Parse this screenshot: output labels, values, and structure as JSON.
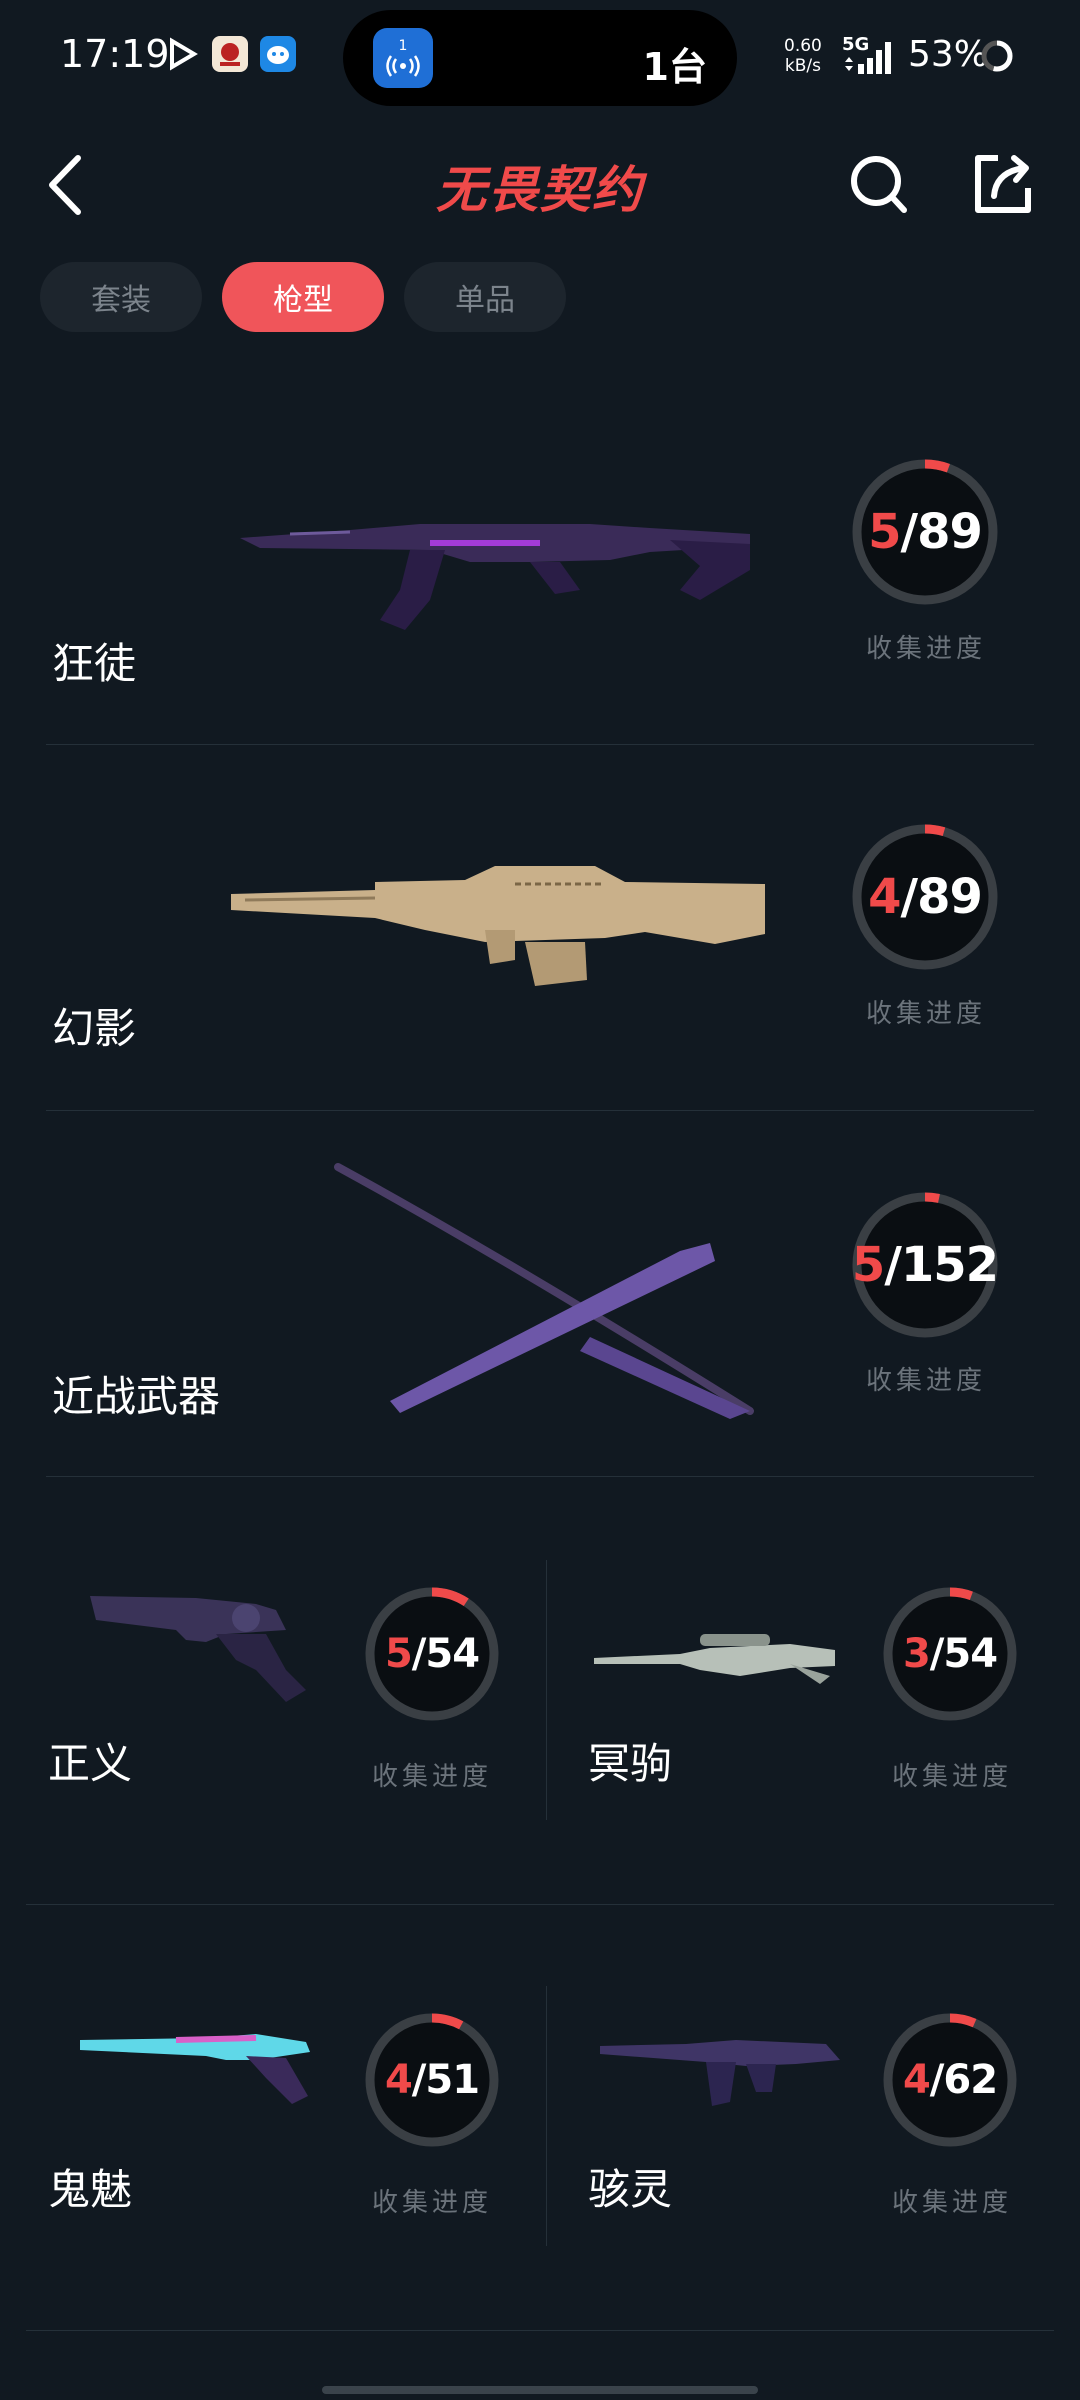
{
  "status": {
    "time": "17:19",
    "island_count": "1台",
    "island_badge": "1",
    "net_speed_value": "0.60",
    "net_speed_unit": "kB/s",
    "network": "5G",
    "battery": "53%"
  },
  "header": {
    "title": "无畏契约"
  },
  "tabs": [
    {
      "label": "套装",
      "active": false
    },
    {
      "label": "枪型",
      "active": true
    },
    {
      "label": "单品",
      "active": false
    }
  ],
  "progress_label": "收集进度",
  "colors": {
    "accent": "#f04a4a",
    "background": "#111921",
    "tab_active": "#f0555a"
  },
  "rows": [
    {
      "name": "狂徒",
      "current": "5",
      "total": "89",
      "progress": 0.056
    },
    {
      "name": "幻影",
      "current": "4",
      "total": "89",
      "progress": 0.045
    },
    {
      "name": "近战武器",
      "current": "5",
      "total": "152",
      "progress": 0.033
    }
  ],
  "cells": [
    {
      "name": "正义",
      "current": "5",
      "total": "54",
      "progress": 0.093
    },
    {
      "name": "冥驹",
      "current": "3",
      "total": "54",
      "progress": 0.056
    },
    {
      "name": "鬼魅",
      "current": "4",
      "total": "51",
      "progress": 0.078
    },
    {
      "name": "骇灵",
      "current": "4",
      "total": "62",
      "progress": 0.065
    }
  ]
}
